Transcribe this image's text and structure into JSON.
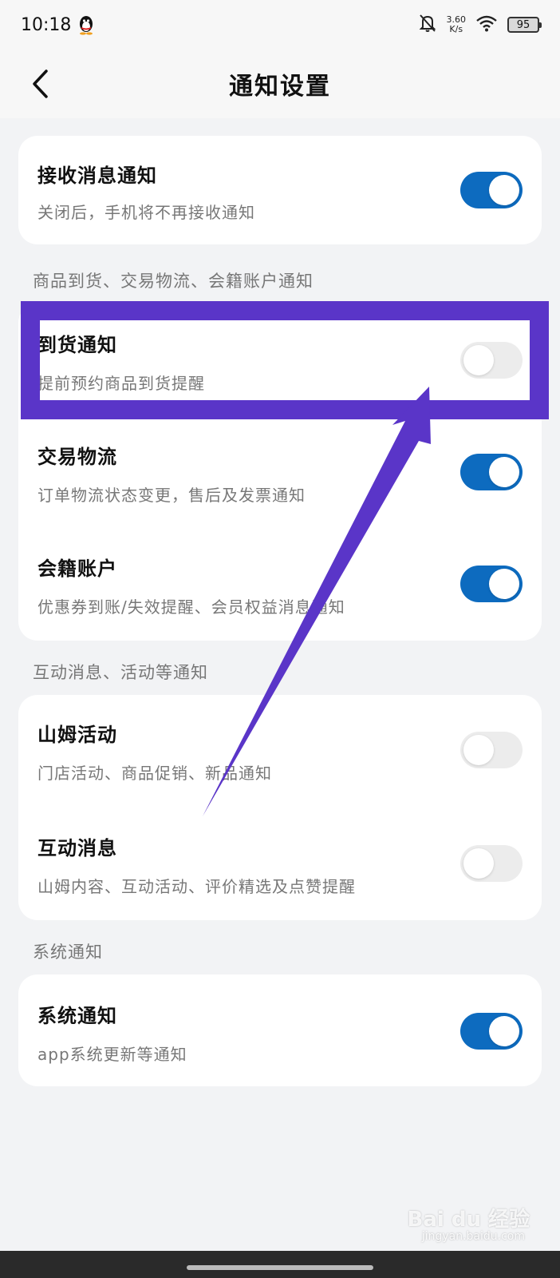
{
  "status_bar": {
    "time": "10:18",
    "speed_value": "3.60",
    "speed_unit": "K/s",
    "battery": "95"
  },
  "header": {
    "title": "通知设置"
  },
  "main_card": {
    "title": "接收消息通知",
    "desc": "关闭后，手机将不再接收通知",
    "enabled": true
  },
  "sections": [
    {
      "label": "商品到货、交易物流、会籍账户通知",
      "items": [
        {
          "title": "到货通知",
          "desc": "提前预约商品到货提醒",
          "enabled": false
        },
        {
          "title": "交易物流",
          "desc": "订单物流状态变更，售后及发票通知",
          "enabled": true
        },
        {
          "title": "会籍账户",
          "desc": "优惠券到账/失效提醒、会员权益消息通知",
          "enabled": true
        }
      ]
    },
    {
      "label": "互动消息、活动等通知",
      "items": [
        {
          "title": "山姆活动",
          "desc": "门店活动、商品促销、新品通知",
          "enabled": false
        },
        {
          "title": "互动消息",
          "desc": "山姆内容、互动活动、评价精选及点赞提醒",
          "enabled": false
        }
      ]
    },
    {
      "label": "系统通知",
      "items": [
        {
          "title": "系统通知",
          "desc": "app系统更新等通知",
          "enabled": true
        }
      ]
    }
  ],
  "watermark": {
    "brand": "Bai du 经验",
    "url": "jingyan.baidu.com"
  },
  "colors": {
    "toggle_on": "#0d6bbf",
    "toggle_off": "#ececec",
    "annotation": "#5a35c8"
  }
}
